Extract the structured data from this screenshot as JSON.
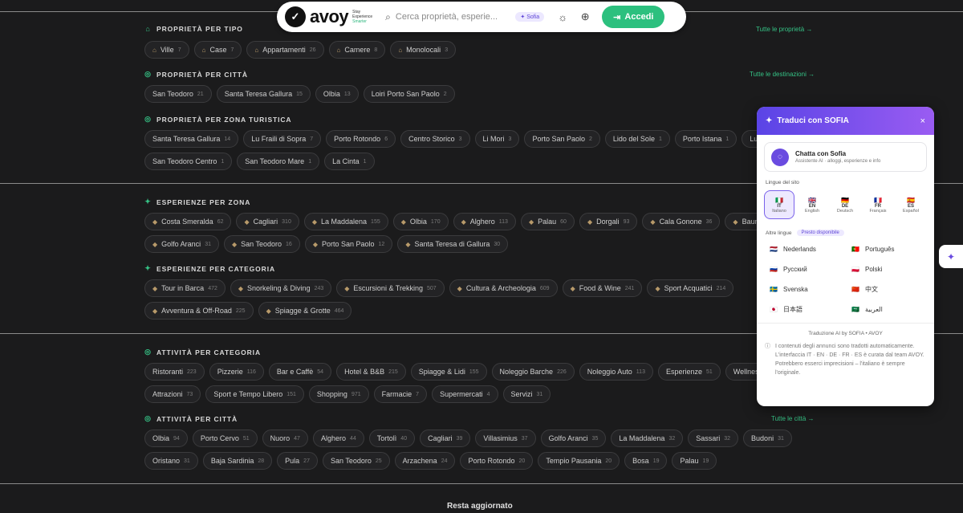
{
  "topbar": {
    "logo_text": "avoy",
    "logo_tag_1": "Stay",
    "logo_tag_2": "Experience",
    "logo_tag_3": "Smarter",
    "search_placeholder": "Cerca proprietà, esperie...",
    "sofia_label": "Sofia",
    "login_label": "Accedi"
  },
  "sections": {
    "prop_tipo": {
      "title": "Proprietà per tipo",
      "see_all": "Tutte le proprietà →",
      "chips": [
        {
          "label": "Ville",
          "count": "7"
        },
        {
          "label": "Case",
          "count": "7"
        },
        {
          "label": "Appartamenti",
          "count": "26"
        },
        {
          "label": "Camere",
          "count": "8"
        },
        {
          "label": "Monolocali",
          "count": "3"
        }
      ]
    },
    "prop_citta": {
      "title": "Proprietà per città",
      "see_all": "Tutte le destinazioni →",
      "chips": [
        {
          "label": "San Teodoro",
          "count": "21"
        },
        {
          "label": "Santa Teresa Gallura",
          "count": "15"
        },
        {
          "label": "Olbia",
          "count": "13"
        },
        {
          "label": "Loiri Porto San Paolo",
          "count": "2"
        }
      ]
    },
    "prop_zona": {
      "title": "Proprietà per zona turistica",
      "chips_row1": [
        {
          "label": "Santa Teresa Gallura",
          "count": "14"
        },
        {
          "label": "Lu Fraili di Sopra",
          "count": "7"
        },
        {
          "label": "Porto Rotondo",
          "count": "6"
        },
        {
          "label": "Centro Storico",
          "count": "3"
        },
        {
          "label": "Li Mori",
          "count": "3"
        },
        {
          "label": "Porto San Paolo",
          "count": "2"
        },
        {
          "label": "Lido del Sole",
          "count": "1"
        },
        {
          "label": "Porto Istana",
          "count": "1"
        },
        {
          "label": "Lu Fr",
          "count": ""
        }
      ],
      "chips_row2": [
        {
          "label": "San Teodoro Centro",
          "count": "1"
        },
        {
          "label": "San Teodoro Mare",
          "count": "1"
        },
        {
          "label": "La Cinta",
          "count": "1"
        }
      ]
    },
    "esp_zona": {
      "title": "Esperienze per zona",
      "chips_row1": [
        {
          "label": "Costa Smeralda",
          "count": "62"
        },
        {
          "label": "Cagliari",
          "count": "310"
        },
        {
          "label": "La Maddalena",
          "count": "155"
        },
        {
          "label": "Olbia",
          "count": "170"
        },
        {
          "label": "Alghero",
          "count": "113"
        },
        {
          "label": "Palau",
          "count": "60"
        },
        {
          "label": "Dorgali",
          "count": "93"
        },
        {
          "label": "Cala Gonone",
          "count": "36"
        },
        {
          "label": "Baunei",
          "count": ""
        }
      ],
      "chips_row2": [
        {
          "label": "Golfo Aranci",
          "count": "31"
        },
        {
          "label": "San Teodoro",
          "count": "16"
        },
        {
          "label": "Porto San Paolo",
          "count": "12"
        },
        {
          "label": "Santa Teresa di Gallura",
          "count": "30"
        }
      ]
    },
    "esp_cat": {
      "title": "Esperienze per categoria",
      "chips_row1": [
        {
          "label": "Tour in Barca",
          "count": "472"
        },
        {
          "label": "Snorkeling & Diving",
          "count": "243"
        },
        {
          "label": "Escursioni & Trekking",
          "count": "507"
        },
        {
          "label": "Cultura & Archeologia",
          "count": "609"
        },
        {
          "label": "Food & Wine",
          "count": "241"
        },
        {
          "label": "Sport Acquatici",
          "count": "214"
        }
      ],
      "chips_row2": [
        {
          "label": "Avventura & Off-Road",
          "count": "225"
        },
        {
          "label": "Spiagge & Grotte",
          "count": "464"
        }
      ]
    },
    "att_cat": {
      "title": "Attività per categoria",
      "chips_row1": [
        {
          "label": "Ristoranti",
          "count": "223"
        },
        {
          "label": "Pizzerie",
          "count": "116"
        },
        {
          "label": "Bar e Caffè",
          "count": "54"
        },
        {
          "label": "Hotel & B&B",
          "count": "215"
        },
        {
          "label": "Spiagge & Lidi",
          "count": "155"
        },
        {
          "label": "Noleggio Barche",
          "count": "226"
        },
        {
          "label": "Noleggio Auto",
          "count": "113"
        },
        {
          "label": "Esperienze",
          "count": "51"
        },
        {
          "label": "Wellness &",
          "count": ""
        }
      ],
      "chips_row2": [
        {
          "label": "Attrazioni",
          "count": "73"
        },
        {
          "label": "Sport e Tempo Libero",
          "count": "151"
        },
        {
          "label": "Shopping",
          "count": "971"
        },
        {
          "label": "Farmacie",
          "count": "7"
        },
        {
          "label": "Supermercati",
          "count": "4"
        },
        {
          "label": "Servizi",
          "count": "31"
        }
      ]
    },
    "att_citta": {
      "title": "Attività per città",
      "see_all": "Tutte le città →",
      "chips_row1": [
        {
          "label": "Olbia",
          "count": "94"
        },
        {
          "label": "Porto Cervo",
          "count": "51"
        },
        {
          "label": "Nuoro",
          "count": "47"
        },
        {
          "label": "Alghero",
          "count": "44"
        },
        {
          "label": "Tortolì",
          "count": "40"
        },
        {
          "label": "Cagliari",
          "count": "39"
        },
        {
          "label": "Villasimius",
          "count": "37"
        },
        {
          "label": "Golfo Aranci",
          "count": "35"
        },
        {
          "label": "La Maddalena",
          "count": "32"
        },
        {
          "label": "Sassari",
          "count": "32"
        },
        {
          "label": "Budoni",
          "count": "31"
        }
      ],
      "chips_row2": [
        {
          "label": "Oristano",
          "count": "31"
        },
        {
          "label": "Baja Sardinia",
          "count": "28"
        },
        {
          "label": "Pula",
          "count": "27"
        },
        {
          "label": "San Teodoro",
          "count": "25"
        },
        {
          "label": "Arzachena",
          "count": "24"
        },
        {
          "label": "Porto Rotondo",
          "count": "20"
        },
        {
          "label": "Tempio Pausania",
          "count": "20"
        },
        {
          "label": "Bosa",
          "count": "19"
        },
        {
          "label": "Palau",
          "count": "19"
        }
      ]
    }
  },
  "translate_panel": {
    "title": "Traduci con SOFIA",
    "close": "×",
    "chat_title": "Chatta con Sofia",
    "chat_subtitle": "Assistente AI · alloggi, esperienze e info",
    "site_languages_label": "Lingue del sito",
    "site_languages": [
      {
        "flag": "🇮🇹",
        "code": "IT",
        "name": "Italiano"
      },
      {
        "flag": "🇬🇧",
        "code": "EN",
        "name": "English"
      },
      {
        "flag": "🇩🇪",
        "code": "DE",
        "name": "Deutsch"
      },
      {
        "flag": "🇫🇷",
        "code": "FR",
        "name": "Français"
      },
      {
        "flag": "🇪🇸",
        "code": "ES",
        "name": "Español"
      }
    ],
    "other_languages_label": "Altre lingue",
    "coming_soon": "Presto disponibile",
    "other_languages": [
      {
        "flag": "🇳🇱",
        "name": "Nederlands"
      },
      {
        "flag": "🇵🇹",
        "name": "Português"
      },
      {
        "flag": "🇷🇺",
        "name": "Русский"
      },
      {
        "flag": "🇵🇱",
        "name": "Polski"
      },
      {
        "flag": "🇸🇪",
        "name": "Svenska"
      },
      {
        "flag": "🇨🇳",
        "name": "中文"
      },
      {
        "flag": "🇯🇵",
        "name": "日本語"
      },
      {
        "flag": "🇸🇦",
        "name": "العربية"
      }
    ],
    "footer_title": "Traduzione AI by SOFIA • AVOY",
    "footer_text": "I contenuti degli annunci sono tradotti automaticamente. L'interfaccia IT · EN · DE · FR · ES è curata dal team AVOY. Potrebbero esserci imprecisioni – l'italiano è sempre l'originale."
  },
  "footer": {
    "newsletter_title": "Resta aggiornato"
  },
  "colors": {
    "accent_green": "#35c285",
    "brand_purple": "#6a4be0",
    "background": "#1b1b1c"
  }
}
